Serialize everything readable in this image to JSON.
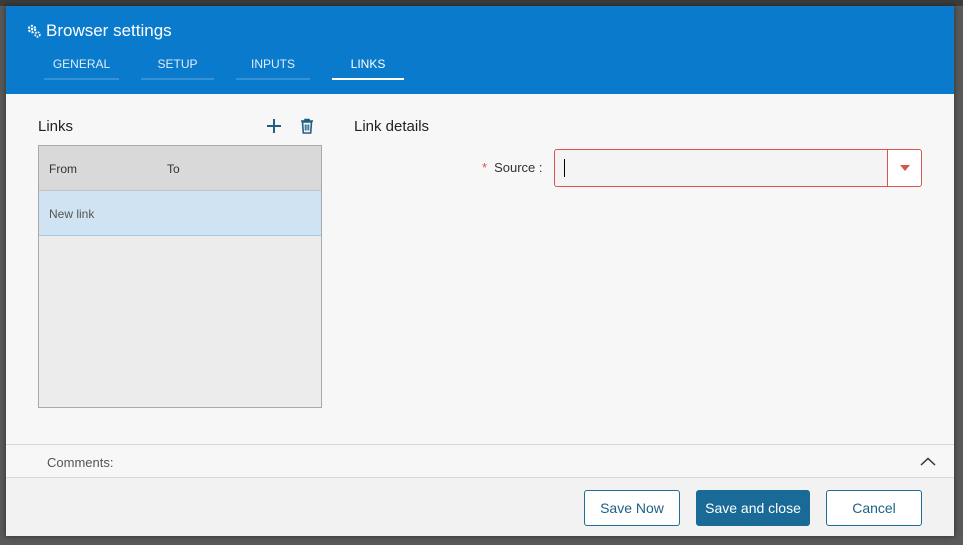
{
  "dialog": {
    "title": "Browser settings",
    "icon": "gears-icon"
  },
  "tabs": [
    {
      "label": "GENERAL",
      "active": false
    },
    {
      "label": "SETUP",
      "active": false
    },
    {
      "label": "INPUTS",
      "active": false
    },
    {
      "label": "LINKS",
      "active": true
    }
  ],
  "links_panel": {
    "title": "Links",
    "add_icon": "plus-icon",
    "delete_icon": "trash-icon",
    "columns": [
      "From",
      "To"
    ],
    "rows": [
      {
        "from": "New link",
        "to": "",
        "selected": true
      }
    ]
  },
  "link_details": {
    "title": "Link details",
    "source_label": "Source :",
    "source_required_marker": "*",
    "source_value": "",
    "dropdown_icon": "caret-down-icon"
  },
  "comments": {
    "label": "Comments:",
    "toggle_icon": "chevron-up-icon"
  },
  "footer": {
    "save_now": "Save Now",
    "save_close": "Save and close",
    "cancel": "Cancel"
  },
  "colors": {
    "header": "#0a7acc",
    "primary_button": "#1a6a98",
    "error": "#d9534f",
    "selected_row": "#cfe3f2"
  }
}
